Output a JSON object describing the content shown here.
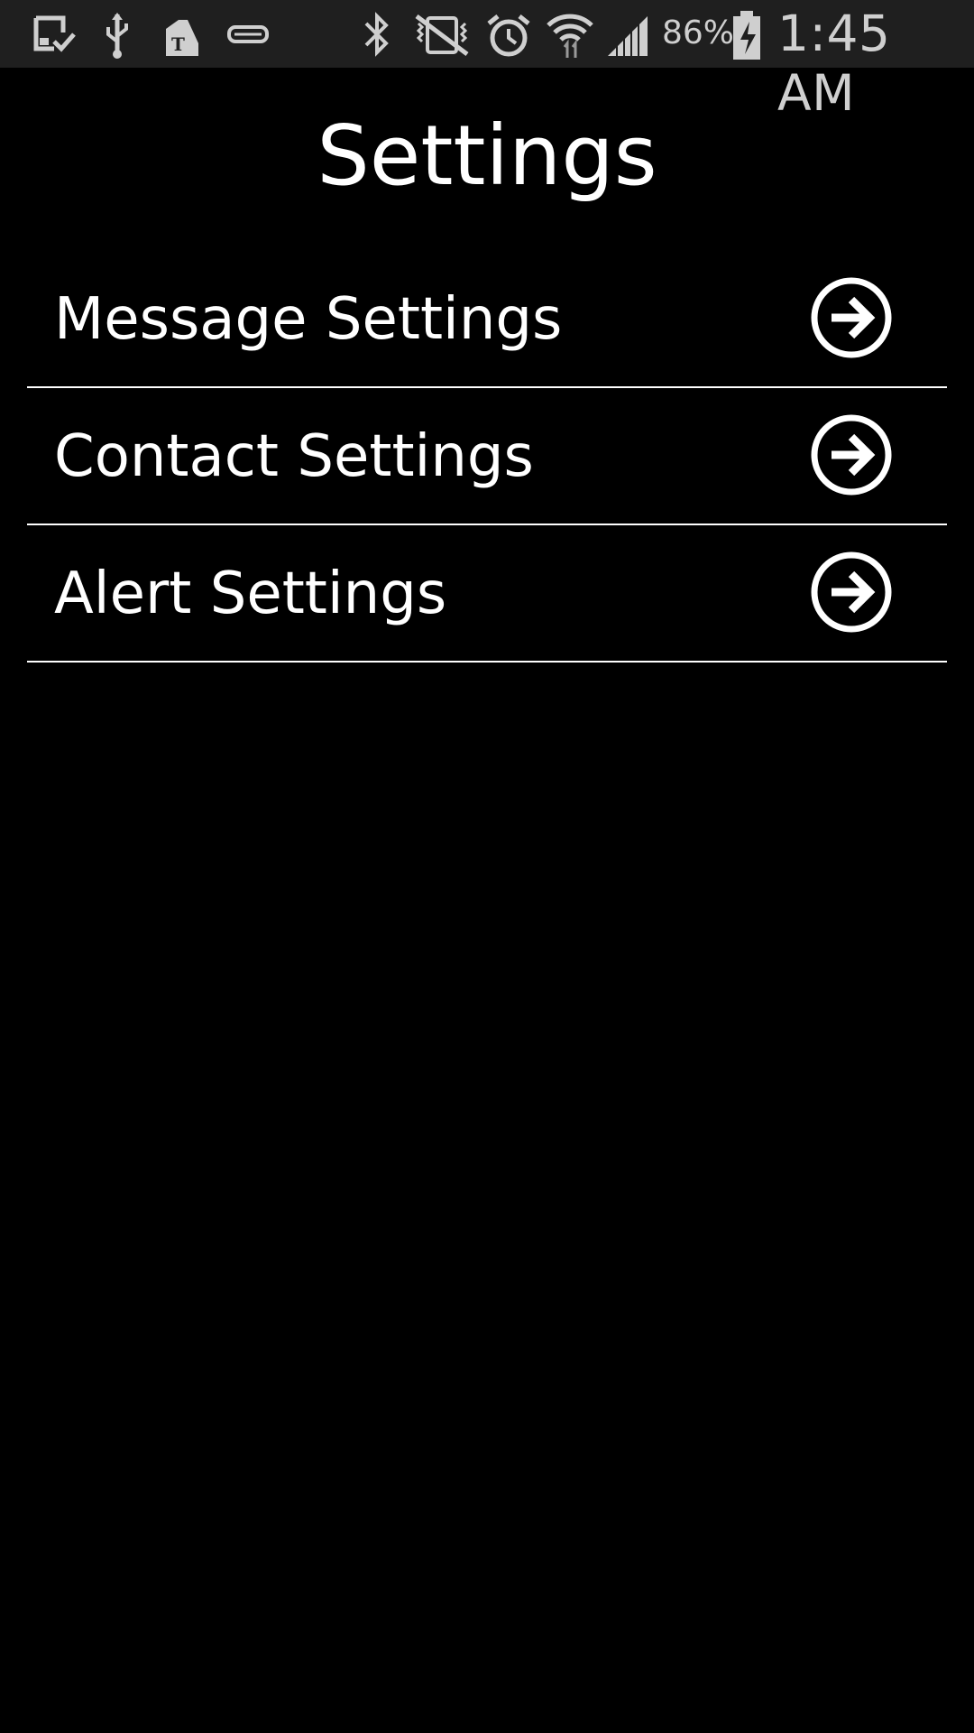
{
  "status_bar": {
    "battery_percent": "86%",
    "time": "1:45 AM",
    "left_icons": [
      "download-done-icon",
      "usb-icon",
      "tmobile-icon",
      "nfc-card-icon"
    ],
    "right_icons": [
      "bluetooth-icon",
      "vibrate-off-icon",
      "alarm-icon",
      "wifi-icon",
      "signal-icon",
      "battery-charging-icon"
    ]
  },
  "header": {
    "title": "Settings"
  },
  "settings": {
    "items": [
      {
        "label": "Message Settings",
        "icon": "arrow-right-circle-icon"
      },
      {
        "label": "Contact Settings",
        "icon": "arrow-right-circle-icon"
      },
      {
        "label": "Alert Settings",
        "icon": "arrow-right-circle-icon"
      }
    ]
  },
  "colors": {
    "background": "#000000",
    "status_bar": "#1f1f1f",
    "text": "#ffffff",
    "status_text": "#cfcfcf"
  }
}
